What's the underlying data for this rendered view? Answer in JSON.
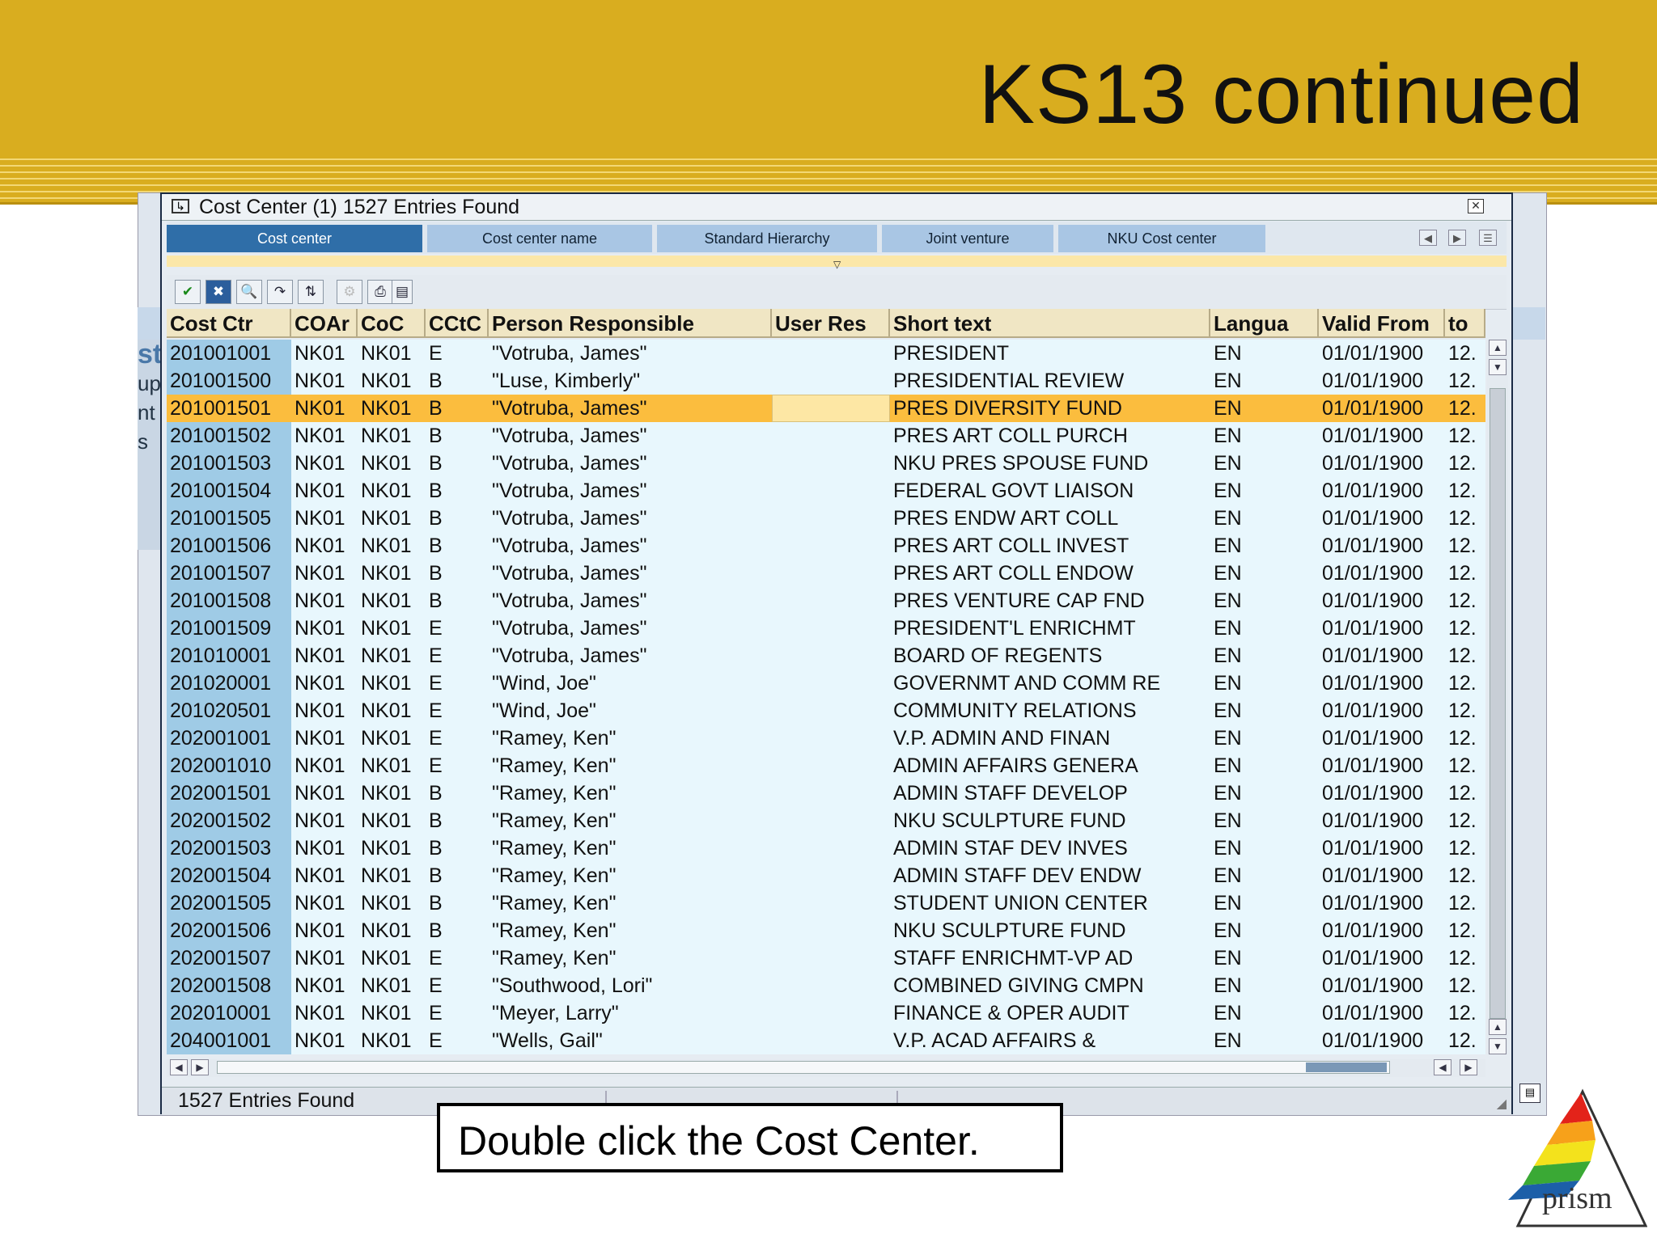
{
  "slide": {
    "title": "KS13 continued"
  },
  "background": {
    "left_labels": [
      "st",
      "up",
      "nt",
      "s"
    ]
  },
  "dialog": {
    "title": "Cost Center (1) 1527 Entries Found",
    "close_icon": "close-icon",
    "tabs": [
      {
        "label": "Cost center",
        "active": true
      },
      {
        "label": "Cost center name",
        "active": false
      },
      {
        "label": "Standard Hierarchy",
        "active": false
      },
      {
        "label": "Joint venture",
        "active": false
      },
      {
        "label": "NKU Cost center",
        "active": false
      }
    ],
    "toolbar_icons": [
      "check-icon",
      "cancel-icon",
      "find-icon",
      "find-next-icon",
      "sort-icon",
      "settings-icon",
      "print-icon",
      "list-icon"
    ],
    "status": "1527 Entries Found"
  },
  "table": {
    "columns": [
      "Cost Ctr",
      "COAr",
      "CoC",
      "CCtC",
      "Person Responsible",
      "User Res",
      "Short text",
      "Langua",
      "Valid From",
      "to"
    ],
    "selected_row": 2,
    "rows": [
      [
        "201001001",
        "NK01",
        "NK01",
        "E",
        "\"Votruba, James\"",
        "",
        "PRESIDENT",
        "EN",
        "01/01/1900",
        "12."
      ],
      [
        "201001500",
        "NK01",
        "NK01",
        "B",
        "\"Luse, Kimberly\"",
        "",
        "PRESIDENTIAL REVIEW",
        "EN",
        "01/01/1900",
        "12."
      ],
      [
        "201001501",
        "NK01",
        "NK01",
        "B",
        "\"Votruba, James\"",
        "",
        "PRES DIVERSITY FUND",
        "EN",
        "01/01/1900",
        "12."
      ],
      [
        "201001502",
        "NK01",
        "NK01",
        "B",
        "\"Votruba, James\"",
        "",
        "PRES ART COLL PURCH",
        "EN",
        "01/01/1900",
        "12."
      ],
      [
        "201001503",
        "NK01",
        "NK01",
        "B",
        "\"Votruba, James\"",
        "",
        "NKU PRES SPOUSE FUND",
        "EN",
        "01/01/1900",
        "12."
      ],
      [
        "201001504",
        "NK01",
        "NK01",
        "B",
        "\"Votruba, James\"",
        "",
        "FEDERAL GOVT LIAISON",
        "EN",
        "01/01/1900",
        "12."
      ],
      [
        "201001505",
        "NK01",
        "NK01",
        "B",
        "\"Votruba, James\"",
        "",
        "PRES ENDW ART COLL",
        "EN",
        "01/01/1900",
        "12."
      ],
      [
        "201001506",
        "NK01",
        "NK01",
        "B",
        "\"Votruba, James\"",
        "",
        "PRES ART COLL INVEST",
        "EN",
        "01/01/1900",
        "12."
      ],
      [
        "201001507",
        "NK01",
        "NK01",
        "B",
        "\"Votruba, James\"",
        "",
        "PRES ART COLL ENDOW",
        "EN",
        "01/01/1900",
        "12."
      ],
      [
        "201001508",
        "NK01",
        "NK01",
        "B",
        "\"Votruba, James\"",
        "",
        "PRES VENTURE CAP FND",
        "EN",
        "01/01/1900",
        "12."
      ],
      [
        "201001509",
        "NK01",
        "NK01",
        "E",
        "\"Votruba, James\"",
        "",
        "PRESIDENT'L ENRICHMT",
        "EN",
        "01/01/1900",
        "12."
      ],
      [
        "201010001",
        "NK01",
        "NK01",
        "E",
        "\"Votruba, James\"",
        "",
        "BOARD OF REGENTS",
        "EN",
        "01/01/1900",
        "12."
      ],
      [
        "201020001",
        "NK01",
        "NK01",
        "E",
        "\"Wind, Joe\"",
        "",
        "GOVERNMT AND COMM RE",
        "EN",
        "01/01/1900",
        "12."
      ],
      [
        "201020501",
        "NK01",
        "NK01",
        "E",
        "\"Wind, Joe\"",
        "",
        "COMMUNITY RELATIONS",
        "EN",
        "01/01/1900",
        "12."
      ],
      [
        "202001001",
        "NK01",
        "NK01",
        "E",
        "\"Ramey, Ken\"",
        "",
        "V.P. ADMIN AND FINAN",
        "EN",
        "01/01/1900",
        "12."
      ],
      [
        "202001010",
        "NK01",
        "NK01",
        "E",
        "\"Ramey, Ken\"",
        "",
        "ADMIN AFFAIRS GENERA",
        "EN",
        "01/01/1900",
        "12."
      ],
      [
        "202001501",
        "NK01",
        "NK01",
        "B",
        "\"Ramey, Ken\"",
        "",
        "ADMIN STAFF DEVELOP",
        "EN",
        "01/01/1900",
        "12."
      ],
      [
        "202001502",
        "NK01",
        "NK01",
        "B",
        "\"Ramey, Ken\"",
        "",
        "NKU SCULPTURE FUND",
        "EN",
        "01/01/1900",
        "12."
      ],
      [
        "202001503",
        "NK01",
        "NK01",
        "B",
        "\"Ramey, Ken\"",
        "",
        "ADMIN STAF DEV INVES",
        "EN",
        "01/01/1900",
        "12."
      ],
      [
        "202001504",
        "NK01",
        "NK01",
        "B",
        "\"Ramey, Ken\"",
        "",
        "ADMIN STAFF DEV ENDW",
        "EN",
        "01/01/1900",
        "12."
      ],
      [
        "202001505",
        "NK01",
        "NK01",
        "B",
        "\"Ramey, Ken\"",
        "",
        "STUDENT UNION CENTER",
        "EN",
        "01/01/1900",
        "12."
      ],
      [
        "202001506",
        "NK01",
        "NK01",
        "B",
        "\"Ramey, Ken\"",
        "",
        "NKU SCULPTURE FUND",
        "EN",
        "01/01/1900",
        "12."
      ],
      [
        "202001507",
        "NK01",
        "NK01",
        "E",
        "\"Ramey, Ken\"",
        "",
        "STAFF ENRICHMT-VP AD",
        "EN",
        "01/01/1900",
        "12."
      ],
      [
        "202001508",
        "NK01",
        "NK01",
        "E",
        "\"Southwood, Lori\"",
        "",
        "COMBINED GIVING CMPN",
        "EN",
        "01/01/1900",
        "12."
      ],
      [
        "202010001",
        "NK01",
        "NK01",
        "E",
        "\"Meyer, Larry\"",
        "",
        "FINANCE & OPER AUDIT",
        "EN",
        "01/01/1900",
        "12."
      ],
      [
        "204001001",
        "NK01",
        "NK01",
        "E",
        "\"Wells, Gail\"",
        "",
        "V.P. ACAD AFFAIRS &",
        "EN",
        "01/01/1900",
        "12."
      ]
    ]
  },
  "callout": {
    "text": "Double click the Cost Center."
  },
  "logo": {
    "text": "prism",
    "colors": [
      "#e3231a",
      "#f7a11a",
      "#f3e21c",
      "#3aa935",
      "#1c5fa8"
    ]
  }
}
